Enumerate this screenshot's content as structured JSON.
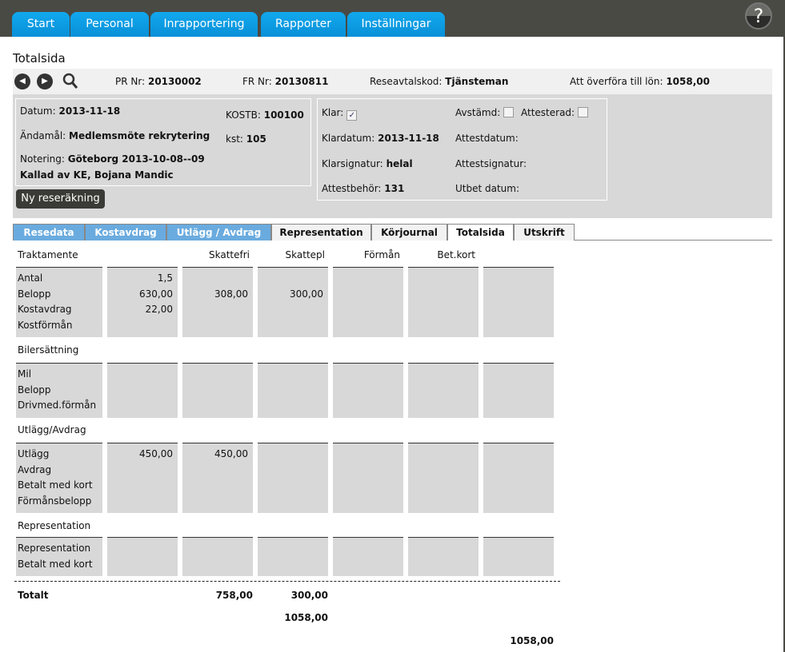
{
  "nav": {
    "tabs": [
      "Start",
      "Personal",
      "Inrapportering",
      "Rapporter",
      "Inställningar"
    ],
    "help": "?"
  },
  "page_title": "Totalsida",
  "info": {
    "pr_label": "PR Nr:",
    "pr": "20130002",
    "fr_label": "FR Nr:",
    "fr": "20130811",
    "avtal_label": "Reseavtalskod:",
    "avtal": "Tjänsteman",
    "overfor_label": "Att överföra till lön:",
    "overfor": "1058,00"
  },
  "details": {
    "datum_label": "Datum:",
    "datum": "2013-11-18",
    "andamal_label": "Ändamål:",
    "andamal": "Medlemsmöte rekrytering",
    "notering_label": "Notering:",
    "notering": "Göteborg 2013-10-08--09",
    "notering2": "Kallad av KE, Bojana Mandic",
    "kostb_label": "KOSTB:",
    "kostb": "100100",
    "kst_label": "kst:",
    "kst": "105",
    "klar_label": "Klar:",
    "klar_checked": true,
    "avstamd_label": "Avstämd:",
    "avstamd_checked": false,
    "attesterad_label": "Attesterad:",
    "attesterad_checked": false,
    "klardatum_label": "Klardatum:",
    "klardatum": "2013-11-18",
    "attestdatum_label": "Attestdatum:",
    "klarsignatur_label": "Klarsignatur:",
    "klarsignatur": "helal",
    "attestsignatur_label": "Attestsignatur:",
    "attestbehor_label": "Attestbehör:",
    "attestbehor": "131",
    "utbet_label": "Utbet datum:"
  },
  "new_button": "Ny reseräkning",
  "subtabs": [
    {
      "label": "Resedata",
      "style": "blue"
    },
    {
      "label": "Kostavdrag",
      "style": "blue"
    },
    {
      "label": "Utlägg / Avdrag",
      "style": "blue"
    },
    {
      "label": "Representation",
      "style": "white"
    },
    {
      "label": "Körjournal",
      "style": "white"
    },
    {
      "label": "Totalsida",
      "style": "active"
    },
    {
      "label": "Utskrift",
      "style": "white"
    }
  ],
  "table": {
    "headers": [
      "",
      "Skattefri",
      "Skattepl",
      "Förmån",
      "Bet.kort",
      ""
    ],
    "sections": [
      {
        "title": "Traktamente",
        "rows": [
          [
            "Antal",
            "1,5",
            "",
            "",
            "",
            "",
            ""
          ],
          [
            "Belopp",
            "630,00",
            "308,00",
            "300,00",
            "",
            "",
            ""
          ],
          [
            "Kostavdrag",
            "22,00",
            "",
            "",
            "",
            "",
            ""
          ],
          [
            "Kostförmån",
            "",
            "",
            "",
            "",
            "",
            ""
          ]
        ]
      },
      {
        "title": "Bilersättning",
        "rows": [
          [
            "Mil",
            "",
            "",
            "",
            "",
            "",
            ""
          ],
          [
            "Belopp",
            "",
            "",
            "",
            "",
            "",
            ""
          ],
          [
            "Drivmed.förmån",
            "",
            "",
            "",
            "",
            "",
            ""
          ]
        ]
      },
      {
        "title": "Utlägg/Avdrag",
        "rows": [
          [
            "Utlägg",
            "450,00",
            "450,00",
            "",
            "",
            "",
            ""
          ],
          [
            "Avdrag",
            "",
            "",
            "",
            "",
            "",
            ""
          ],
          [
            "Betalt med kort",
            "",
            "",
            "",
            "",
            "",
            ""
          ],
          [
            "Förmånsbelopp",
            "",
            "",
            "",
            "",
            "",
            ""
          ]
        ]
      },
      {
        "title": "Representation",
        "rows": [
          [
            "Representation",
            "",
            "",
            "",
            "",
            "",
            ""
          ],
          [
            "Betalt med kort",
            "",
            "",
            "",
            "",
            "",
            ""
          ]
        ]
      }
    ],
    "total_label": "Totalt",
    "total_skattefri": "758,00",
    "total_skattepl": "300,00",
    "total_sum": "1058,00",
    "grand_total": "1058,00"
  }
}
